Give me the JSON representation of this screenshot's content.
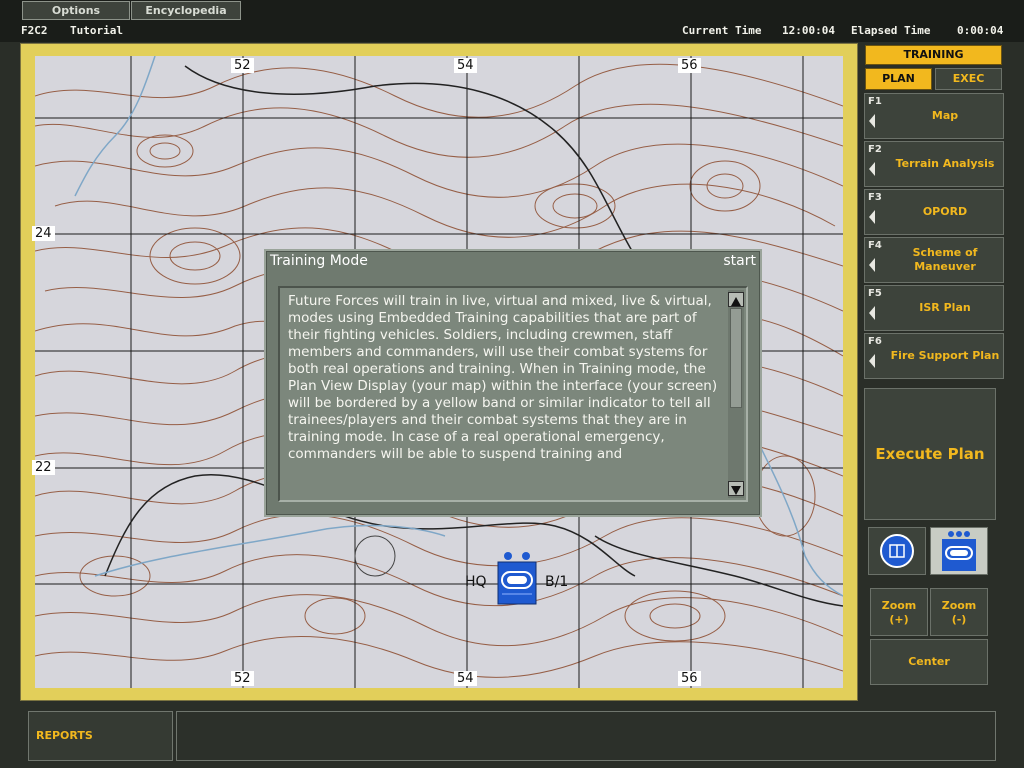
{
  "menu": {
    "options_label": "Options",
    "encyclopedia_label": "Encyclopedia"
  },
  "status": {
    "scenario": "F2C2",
    "mode": "Tutorial",
    "current_time_label": "Current Time",
    "current_time": "12:00:04",
    "elapsed_time_label": "Elapsed Time",
    "elapsed_time": "0:00:04"
  },
  "map": {
    "grid_top": [
      "52",
      "54",
      "56"
    ],
    "grid_bottom": [
      "52",
      "54",
      "56"
    ],
    "grid_left": [
      "24",
      "22"
    ],
    "training_band_color": "#e2cf5a",
    "contour_color": "#8b4a2c",
    "road_color": "#222222",
    "river_color": "#7fa7c7"
  },
  "unit": {
    "left_label": "HQ",
    "right_label": "B/1",
    "color": "#1f5ad0"
  },
  "dialog": {
    "title": "Training Mode",
    "start_label": "start",
    "text": "Future Forces will train in live, virtual and mixed, live & virtual, modes using Embedded Training capabilities that are part of their fighting vehicles. Soldiers, including crewmen, staff members and commanders, will use their combat systems for both real operations and training.  When in Training mode, the Plan View Display (your map) within the interface (your screen) will be bordered by a yellow band or similar indicator to tell all trainees/players and their combat systems that they are in training mode.  In case of a real operational emergency, commanders will be able to suspend training and"
  },
  "panel": {
    "training_label": "TRAINING",
    "plan_label": "PLAN",
    "exec_label": "EXEC",
    "fkeys": [
      {
        "key": "F1",
        "label": "Map"
      },
      {
        "key": "F2",
        "label": "Terrain Analysis"
      },
      {
        "key": "F3",
        "label": "OPORD"
      },
      {
        "key": "F4",
        "label": "Scheme of Maneuver"
      },
      {
        "key": "F5",
        "label": "ISR Plan"
      },
      {
        "key": "F6",
        "label": "Fire Support Plan"
      }
    ],
    "execute_label": "Execute Plan",
    "zoom_in_label": "Zoom\n(+)",
    "zoom_out_label": "Zoom\n(-)",
    "center_label": "Center"
  },
  "bottom": {
    "reports_label": "REPORTS"
  }
}
